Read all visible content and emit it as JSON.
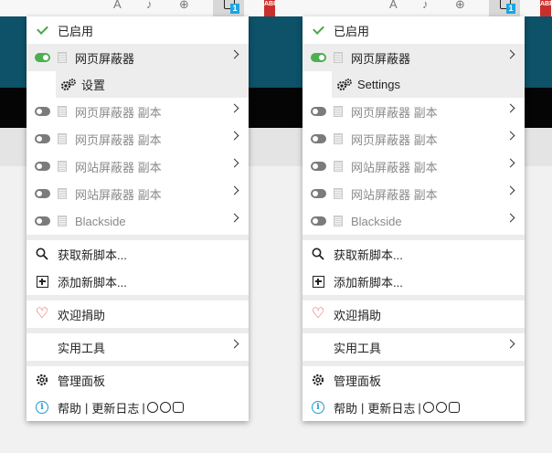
{
  "toolbar": {
    "extension_badge": "1",
    "abp_label": "ABP"
  },
  "menus": [
    {
      "status_label": "已启用",
      "active_script": "网页屏蔽器",
      "active_submenu_label": "设置",
      "scripts": [
        {
          "name": "网页屏蔽器 副本",
          "enabled": false
        },
        {
          "name": "网页屏蔽器 副本",
          "enabled": false
        },
        {
          "name": "网站屏蔽器 副本",
          "enabled": false
        },
        {
          "name": "网站屏蔽器 副本",
          "enabled": false
        },
        {
          "name": "Blackside",
          "enabled": false
        }
      ],
      "get_scripts": "获取新脚本...",
      "add_script": "添加新脚本...",
      "donate": "欢迎捐助",
      "utilities": "实用工具",
      "dashboard": "管理面板",
      "help": "帮助",
      "divider": "|",
      "changelog": "更新日志"
    },
    {
      "status_label": "已启用",
      "active_script": "网页屏蔽器",
      "active_submenu_label": "Settings",
      "scripts": [
        {
          "name": "网页屏蔽器 副本",
          "enabled": false
        },
        {
          "name": "网页屏蔽器 副本",
          "enabled": false
        },
        {
          "name": "网站屏蔽器 副本",
          "enabled": false
        },
        {
          "name": "网站屏蔽器 副本",
          "enabled": false
        },
        {
          "name": "Blackside",
          "enabled": false
        }
      ],
      "get_scripts": "获取新脚本...",
      "add_script": "添加新脚本...",
      "donate": "欢迎捐助",
      "utilities": "实用工具",
      "dashboard": "管理面板",
      "help": "帮助",
      "divider": "|",
      "changelog": "更新日志"
    }
  ],
  "colors": {
    "toggle_on": "#4caf50",
    "toggle_off": "#7b7b7b",
    "check": "#4aa64a",
    "heart": "#e53935",
    "info": "#1a9ad6",
    "badge": "#1aa6e4",
    "page_teal": "#0d5269"
  },
  "icons": [
    "check-icon",
    "toggle-icon",
    "script-doc-icon",
    "gears-icon",
    "chevron-right-icon",
    "search-icon",
    "plus-square-icon",
    "heart-icon",
    "gear-icon",
    "info-icon",
    "github-icon",
    "facebook-icon",
    "instagram-icon"
  ]
}
